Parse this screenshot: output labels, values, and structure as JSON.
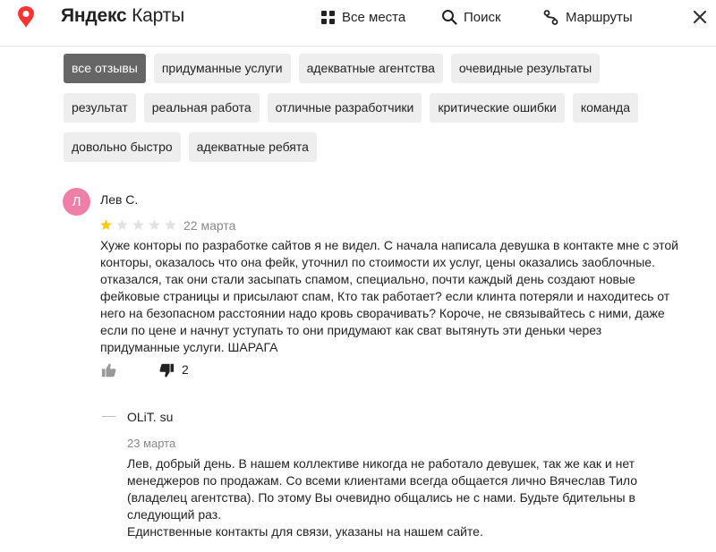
{
  "header": {
    "logo_brand": "Яндекс",
    "logo_product": "Карты",
    "nav": [
      {
        "label": "Все места",
        "icon": "grid-icon"
      },
      {
        "label": "Поиск",
        "icon": "search-icon"
      },
      {
        "label": "Маршруты",
        "icon": "route-icon"
      }
    ]
  },
  "filters": {
    "rows": [
      [
        {
          "label": "все отзывы",
          "active": true
        },
        {
          "label": "придуманные услуги"
        },
        {
          "label": "адекватные агентства"
        },
        {
          "label": "очевидные результаты"
        }
      ],
      [
        {
          "label": "результат"
        },
        {
          "label": "реальная работа"
        },
        {
          "label": "отличные разработчики"
        },
        {
          "label": "критические ошибки"
        },
        {
          "label": "команда"
        }
      ],
      [
        {
          "label": "довольно быстро"
        },
        {
          "label": "адекватные ребята"
        }
      ]
    ]
  },
  "review": {
    "avatar_letter": "Л",
    "avatar_color": "#f07fa8",
    "author": "Лев С.",
    "rating": 1,
    "max_rating": 5,
    "date": "22 марта",
    "text": "Хуже конторы по разработке сайтов я не видел. С начала написала девушка в контакте мне с этой конторы, оказалось что она фейк, уточнил по стоимости их услуг, цены оказались заоблочные. отказался, так они стали засыпать спамом, специально, почти каждый день создают новые фейковые страницы и присылают спам, Кто так работает? если клинта потеряли и находитесь от него на безопасном расстоянии надо кровь сворачивать? Короче, не связывайтесь с ними, даже если по цене и начнут уступать то они придумают как сват вытянуть эти деньки через придуманные услуги. ШАРАГА",
    "dislike_count": "2"
  },
  "reply": {
    "author": "OLiT. su",
    "date": "23 марта",
    "lines": [
      "Лев, добрый день. В нашем коллективе никогда не работало девушек, так же как и нет менеджеров по продажам. Со всеми клиентами всегда общается лично Вячеслав Тило (владелец агентства). По этому Вы очевидно общались не с нами. Будьте бдительны в следующий раз.",
      "Единственные контакты для связи, указаны на нашем сайте."
    ]
  },
  "colors": {
    "star_filled": "#fc0",
    "star_empty": "#e2e2e2",
    "pin": "#f33",
    "active_chip": "#666"
  }
}
